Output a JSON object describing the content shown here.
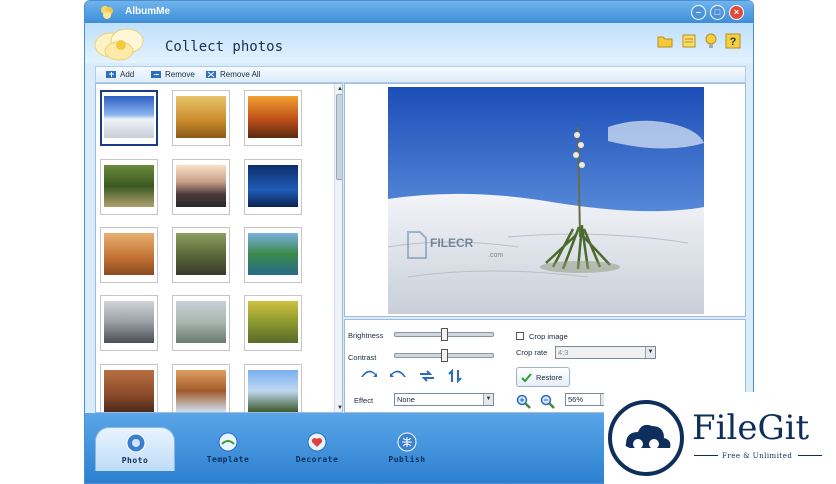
{
  "window": {
    "title": "AlbumMe"
  },
  "header": {
    "title": "Collect photos"
  },
  "toolbar": {
    "add": "Add",
    "remove": "Remove",
    "remove_all": "Remove All"
  },
  "thumbnails": [
    {
      "scene": "white-sands",
      "selected": true
    },
    {
      "scene": "golden-grass"
    },
    {
      "scene": "autumn-tree"
    },
    {
      "scene": "forest-path"
    },
    {
      "scene": "sunset-lake"
    },
    {
      "scene": "blue-night"
    },
    {
      "scene": "desert-canyon"
    },
    {
      "scene": "mossy-rocks"
    },
    {
      "scene": "waterfall-green"
    },
    {
      "scene": "misty-tree"
    },
    {
      "scene": "misty-valley"
    },
    {
      "scene": "autumn-road"
    },
    {
      "scene": "old-room"
    },
    {
      "scene": "waterfall-cliff"
    },
    {
      "scene": "lighthouse"
    }
  ],
  "watermark_text": {
    "brand": "FILECR",
    "domain": ".com"
  },
  "controls": {
    "brightness_label": "Brightness",
    "contrast_label": "Contrast",
    "brightness_value": 0.5,
    "contrast_value": 0.5,
    "crop_image_label": "Crop image",
    "crop_image_checked": false,
    "crop_rate_label": "Crop rate",
    "crop_rate_value": "4:3",
    "restore_label": "Restore",
    "effect_label": "Effect",
    "effect_value": "None",
    "zoom_value": "56%"
  },
  "nav": {
    "tabs": [
      {
        "label": "Photo",
        "active": true
      },
      {
        "label": "Template"
      },
      {
        "label": "Decorate"
      },
      {
        "label": "Publish"
      }
    ]
  },
  "badge": {
    "title": "FileGit",
    "subtitle": "Free & Unlimited"
  },
  "colors": {
    "titlebar": "#3d8ed8",
    "nav": "#2b7fd0",
    "panel_border": "#9fbdda",
    "brand_navy": "#0e2e5c"
  }
}
